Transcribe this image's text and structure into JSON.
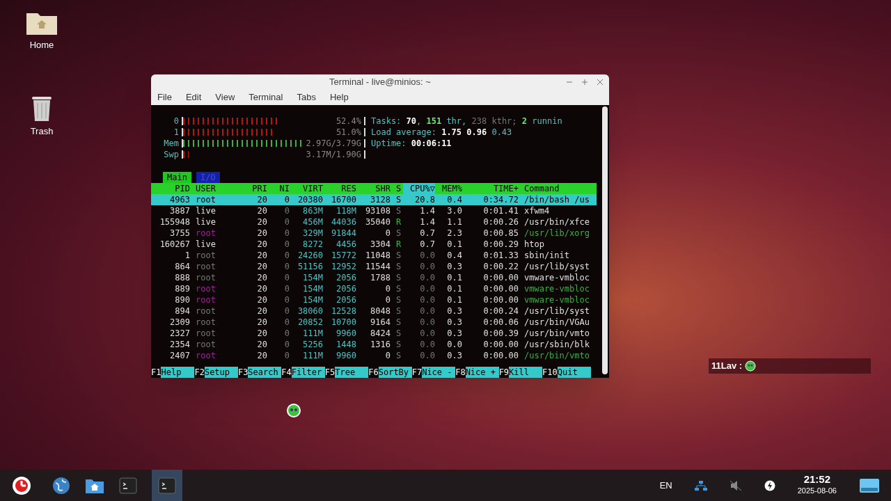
{
  "desktop_icons": [
    {
      "kind": "folder",
      "label": "Home"
    },
    {
      "kind": "trash",
      "label": "Trash"
    }
  ],
  "window": {
    "title": "Terminal - live@minios: ~",
    "menu": [
      "File",
      "Edit",
      "View",
      "Terminal",
      "Tabs",
      "Help"
    ]
  },
  "htop": {
    "meters": [
      {
        "label": "0",
        "kind": "cpu",
        "level": 0.524,
        "reading": "52.4%"
      },
      {
        "label": "1",
        "kind": "cpu",
        "level": 0.51,
        "reading": "51.0%"
      },
      {
        "label": "Mem",
        "kind": "mem",
        "level": 0.78,
        "reading": "2.97G/3.79G"
      },
      {
        "label": "Swp",
        "kind": "swap",
        "level": 0.03,
        "reading": "3.17M/1.90G"
      }
    ],
    "info": [
      [
        {
          "text": "Tasks: ",
          "kind": "label"
        },
        {
          "text": "70",
          "kind": "value"
        },
        {
          "text": ", ",
          "kind": "label"
        },
        {
          "text": "151",
          "kind": "highlight"
        },
        {
          "text": " thr, ",
          "kind": "label"
        },
        {
          "text": "238",
          "kind": "dim"
        },
        {
          "text": " kthr; ",
          "kind": "dim"
        },
        {
          "text": "2",
          "kind": "highlight"
        },
        {
          "text": " runnin",
          "kind": "label"
        }
      ],
      [
        {
          "text": "Load average: ",
          "kind": "label"
        },
        {
          "text": "1.75",
          "kind": "value"
        },
        {
          "text": " 0.96",
          "kind": "value"
        },
        {
          "text": " 0.43",
          "kind": "label"
        }
      ],
      [
        {
          "text": "Uptime: ",
          "kind": "label"
        },
        {
          "text": "00:06:11",
          "kind": "value"
        }
      ]
    ],
    "tabs": [
      {
        "label": "Main",
        "selected": true
      },
      {
        "label": "I/O",
        "selected": false
      }
    ],
    "columns": [
      {
        "label": "PID",
        "sorted": false
      },
      {
        "label": "USER",
        "sorted": false
      },
      {
        "label": "PRI",
        "sorted": false
      },
      {
        "label": "NI",
        "sorted": false
      },
      {
        "label": "VIRT",
        "sorted": false
      },
      {
        "label": "RES",
        "sorted": false
      },
      {
        "label": "SHR",
        "sorted": false
      },
      {
        "label": "S",
        "sorted": false
      },
      {
        "label": "CPU%▽",
        "sorted": true
      },
      {
        "label": "MEM%",
        "sorted": false
      },
      {
        "label": "TIME+",
        "sorted": false
      },
      {
        "label": "Command",
        "sorted": false
      }
    ],
    "processes": [
      {
        "pid": "4963",
        "user": "root",
        "pri": "20",
        "ni": "0",
        "virt": "20380",
        "res": "16700",
        "shr": "3128",
        "s": "S",
        "cpu": "20.8",
        "mem": "0.4",
        "time": "0:34.72",
        "command": "/bin/bash /us",
        "selected": true,
        "thread": false,
        "dimmed": false
      },
      {
        "pid": "3887",
        "user": "live",
        "pri": "20",
        "ni": "0",
        "virt": "863M",
        "res": "118M",
        "shr": "93108",
        "s": "S",
        "cpu": "1.4",
        "mem": "3.0",
        "time": "0:01.41",
        "command": "xfwm4",
        "selected": false,
        "thread": false,
        "dimmed": false
      },
      {
        "pid": "155948",
        "user": "live",
        "pri": "20",
        "ni": "0",
        "virt": "456M",
        "res": "44036",
        "shr": "35040",
        "s": "R",
        "cpu": "1.4",
        "mem": "1.1",
        "time": "0:00.26",
        "command": "/usr/bin/xfce",
        "selected": false,
        "thread": false,
        "dimmed": false
      },
      {
        "pid": "3755",
        "user": "root",
        "pri": "20",
        "ni": "0",
        "virt": "329M",
        "res": "91844",
        "shr": "0",
        "s": "S",
        "cpu": "0.7",
        "mem": "2.3",
        "time": "0:00.85",
        "command": "/usr/lib/xorg",
        "selected": false,
        "thread": true,
        "dimmed": false
      },
      {
        "pid": "160267",
        "user": "live",
        "pri": "20",
        "ni": "0",
        "virt": "8272",
        "res": "4456",
        "shr": "3304",
        "s": "R",
        "cpu": "0.7",
        "mem": "0.1",
        "time": "0:00.29",
        "command": "htop",
        "selected": false,
        "thread": false,
        "dimmed": false
      },
      {
        "pid": "1",
        "user": "root",
        "pri": "20",
        "ni": "0",
        "virt": "24260",
        "res": "15772",
        "shr": "11048",
        "s": "S",
        "cpu": "0.0",
        "mem": "0.4",
        "time": "0:01.33",
        "command": "sbin/init",
        "selected": false,
        "thread": false,
        "dimmed": true
      },
      {
        "pid": "864",
        "user": "root",
        "pri": "20",
        "ni": "0",
        "virt": "51156",
        "res": "12952",
        "shr": "11544",
        "s": "S",
        "cpu": "0.0",
        "mem": "0.3",
        "time": "0:00.22",
        "command": "/usr/lib/syst",
        "selected": false,
        "thread": false,
        "dimmed": true
      },
      {
        "pid": "888",
        "user": "root",
        "pri": "20",
        "ni": "0",
        "virt": "154M",
        "res": "2056",
        "shr": "1788",
        "s": "S",
        "cpu": "0.0",
        "mem": "0.1",
        "time": "0:00.00",
        "command": "vmware-vmbloc",
        "selected": false,
        "thread": false,
        "dimmed": true
      },
      {
        "pid": "889",
        "user": "root",
        "pri": "20",
        "ni": "0",
        "virt": "154M",
        "res": "2056",
        "shr": "0",
        "s": "S",
        "cpu": "0.0",
        "mem": "0.1",
        "time": "0:00.00",
        "command": "vmware-vmbloc",
        "selected": false,
        "thread": true,
        "dimmed": true
      },
      {
        "pid": "890",
        "user": "root",
        "pri": "20",
        "ni": "0",
        "virt": "154M",
        "res": "2056",
        "shr": "0",
        "s": "S",
        "cpu": "0.0",
        "mem": "0.1",
        "time": "0:00.00",
        "command": "vmware-vmbloc",
        "selected": false,
        "thread": true,
        "dimmed": true
      },
      {
        "pid": "894",
        "user": "root",
        "pri": "20",
        "ni": "0",
        "virt": "38060",
        "res": "12528",
        "shr": "8048",
        "s": "S",
        "cpu": "0.0",
        "mem": "0.3",
        "time": "0:00.24",
        "command": "/usr/lib/syst",
        "selected": false,
        "thread": false,
        "dimmed": true
      },
      {
        "pid": "2309",
        "user": "root",
        "pri": "20",
        "ni": "0",
        "virt": "20852",
        "res": "10700",
        "shr": "9164",
        "s": "S",
        "cpu": "0.0",
        "mem": "0.3",
        "time": "0:00.06",
        "command": "/usr/bin/VGAu",
        "selected": false,
        "thread": false,
        "dimmed": true
      },
      {
        "pid": "2327",
        "user": "root",
        "pri": "20",
        "ni": "0",
        "virt": "111M",
        "res": "9960",
        "shr": "8424",
        "s": "S",
        "cpu": "0.0",
        "mem": "0.3",
        "time": "0:00.39",
        "command": "/usr/bin/vmto",
        "selected": false,
        "thread": false,
        "dimmed": true
      },
      {
        "pid": "2354",
        "user": "root",
        "pri": "20",
        "ni": "0",
        "virt": "5256",
        "res": "1448",
        "shr": "1316",
        "s": "S",
        "cpu": "0.0",
        "mem": "0.0",
        "time": "0:00.00",
        "command": "/usr/sbin/blk",
        "selected": false,
        "thread": false,
        "dimmed": true
      },
      {
        "pid": "2407",
        "user": "root",
        "pri": "20",
        "ni": "0",
        "virt": "111M",
        "res": "9960",
        "shr": "0",
        "s": "S",
        "cpu": "0.0",
        "mem": "0.3",
        "time": "0:00.00",
        "command": "/usr/bin/vmto",
        "selected": false,
        "thread": true,
        "dimmed": true
      }
    ],
    "function_keys": [
      {
        "key": "F1",
        "label": "Help"
      },
      {
        "key": "F2",
        "label": "Setup"
      },
      {
        "key": "F3",
        "label": "Search"
      },
      {
        "key": "F4",
        "label": "Filter"
      },
      {
        "key": "F5",
        "label": "Tree"
      },
      {
        "key": "F6",
        "label": "SortBy"
      },
      {
        "key": "F7",
        "label": "Nice -"
      },
      {
        "key": "F8",
        "label": "Nice +"
      },
      {
        "key": "F9",
        "label": "Kill"
      },
      {
        "key": "F10",
        "label": "Quit"
      }
    ]
  },
  "notification": {
    "text": "11Lav :"
  },
  "taskbar": {
    "apps": [
      {
        "kind": "browser",
        "selected": false
      },
      {
        "kind": "files",
        "selected": false
      },
      {
        "kind": "terminal",
        "selected": false
      },
      {
        "kind": "terminal",
        "selected": true
      }
    ],
    "language": "EN",
    "time": "21:52",
    "date": "2025-08-06"
  }
}
